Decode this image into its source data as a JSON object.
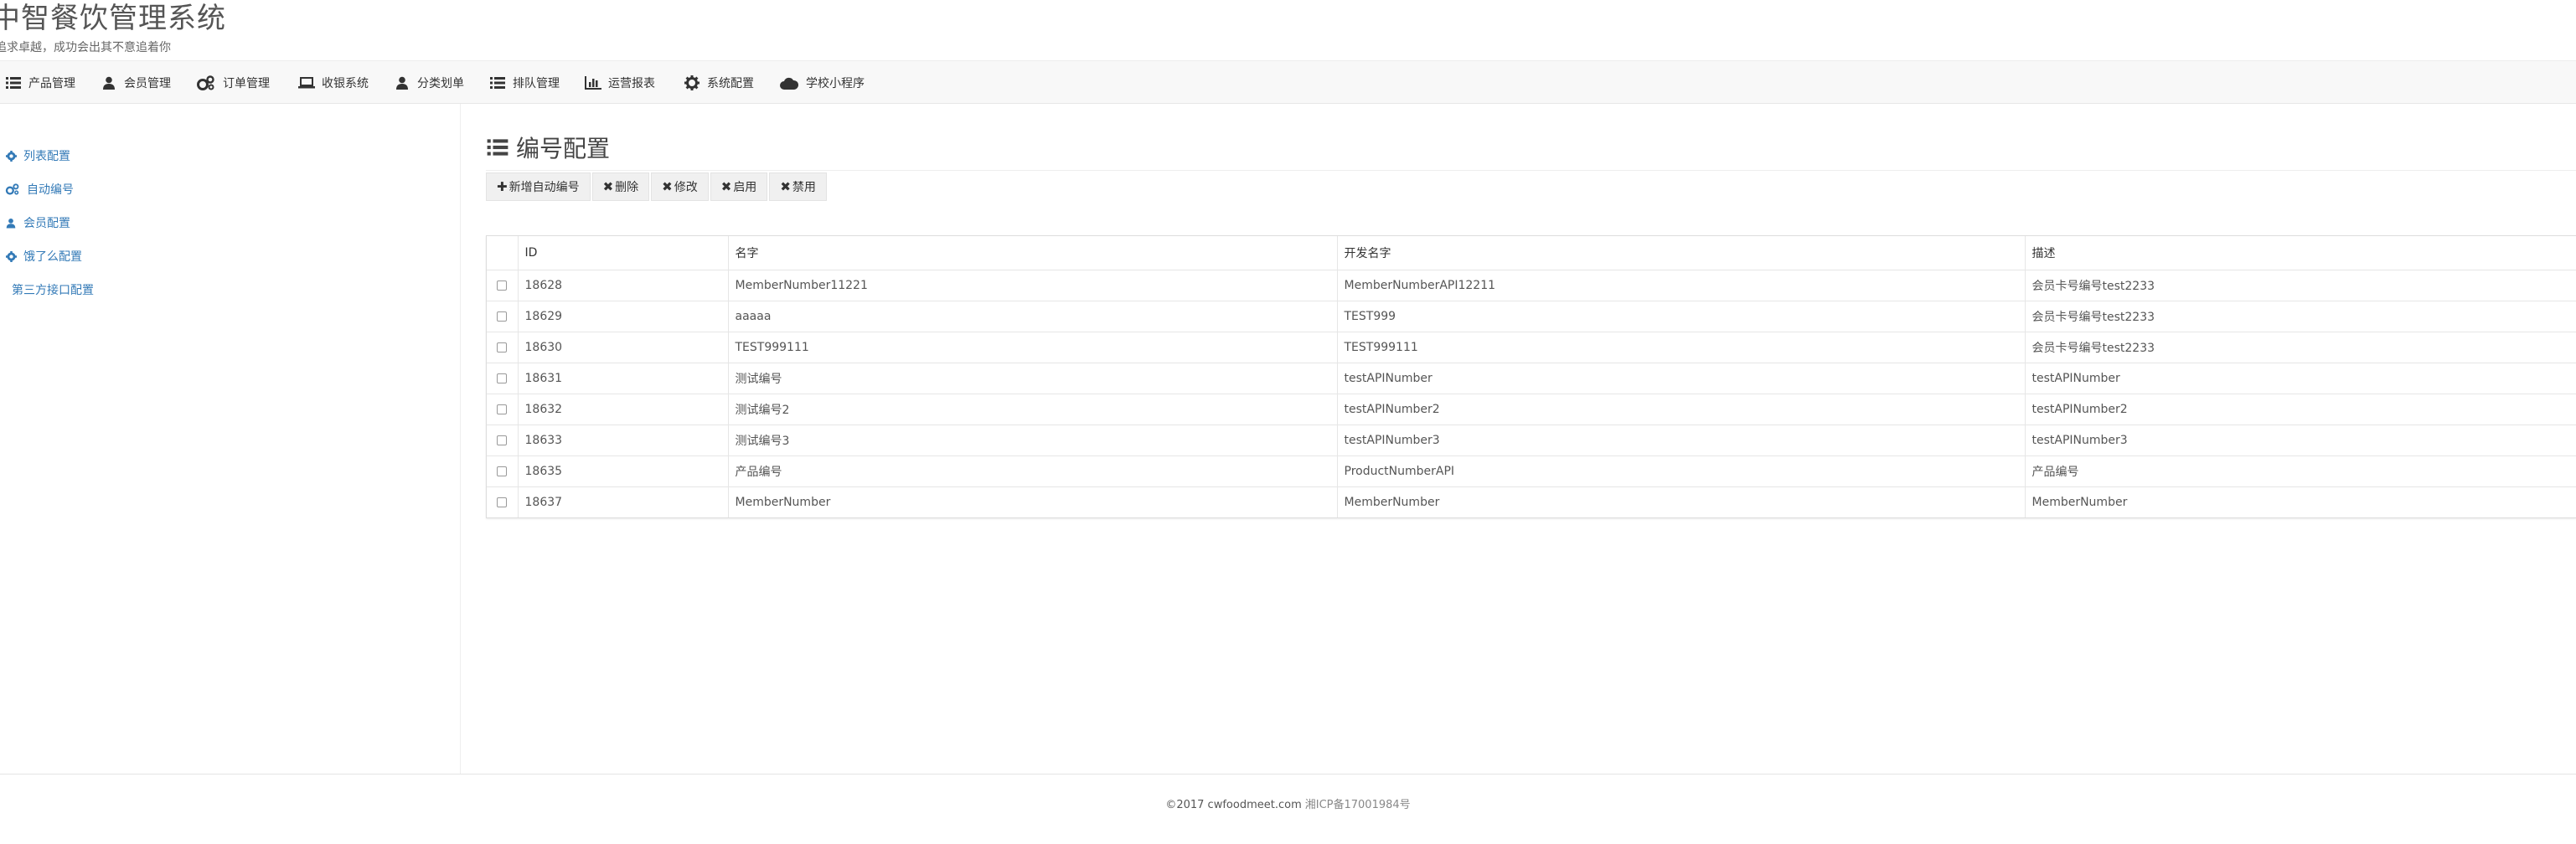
{
  "app": {
    "title": "中智餐饮管理系统",
    "slogan": "追求卓越，成功会出其不意追着你"
  },
  "nav": {
    "items": [
      {
        "label": "产品管理",
        "icon": "list-icon"
      },
      {
        "label": "会员管理",
        "icon": "user-icon"
      },
      {
        "label": "订单管理",
        "icon": "cogs-icon"
      },
      {
        "label": "收银系统",
        "icon": "laptop-icon"
      },
      {
        "label": "分类划单",
        "icon": "user-icon"
      },
      {
        "label": "排队管理",
        "icon": "list-icon"
      },
      {
        "label": "运营报表",
        "icon": "bar-chart-icon"
      },
      {
        "label": "系统配置",
        "icon": "gear-icon"
      },
      {
        "label": "学校小程序",
        "icon": "cloud-icon"
      }
    ]
  },
  "sidebar": {
    "items": [
      {
        "label": "列表配置",
        "icon": "gear-icon"
      },
      {
        "label": "自动编号",
        "icon": "cogs-icon"
      },
      {
        "label": "会员配置",
        "icon": "user-icon"
      },
      {
        "label": "饿了么配置",
        "icon": "gear-icon"
      },
      {
        "label": "第三方接口配置",
        "icon": ""
      }
    ]
  },
  "page": {
    "title": "编号配置",
    "title_icon": "list-icon"
  },
  "toolbar": {
    "add": {
      "label": "新增自动编号",
      "glyph": "✚"
    },
    "delete": {
      "label": "删除",
      "glyph": "✖"
    },
    "edit": {
      "label": "修改",
      "glyph": "✖"
    },
    "enable": {
      "label": "启用",
      "glyph": "✖"
    },
    "disable": {
      "label": "禁用",
      "glyph": "✖"
    }
  },
  "table": {
    "headers": [
      "ID",
      "名字",
      "开发名字",
      "描述"
    ],
    "rows": [
      {
        "id": "18628",
        "name": "MemberNumber11221",
        "dev": "MemberNumberAPI12211",
        "desc": "会员卡号编号test2233"
      },
      {
        "id": "18629",
        "name": "aaaaa",
        "dev": "TEST999",
        "desc": "会员卡号编号test2233"
      },
      {
        "id": "18630",
        "name": "TEST999111",
        "dev": "TEST999111",
        "desc": "会员卡号编号test2233"
      },
      {
        "id": "18631",
        "name": "测试编号",
        "dev": "testAPINumber",
        "desc": "testAPINumber"
      },
      {
        "id": "18632",
        "name": "测试编号2",
        "dev": "testAPINumber2",
        "desc": "testAPINumber2"
      },
      {
        "id": "18633",
        "name": "测试编号3",
        "dev": "testAPINumber3",
        "desc": "testAPINumber3"
      },
      {
        "id": "18635",
        "name": "产品编号",
        "dev": "ProductNumberAPI",
        "desc": "产品编号"
      },
      {
        "id": "18637",
        "name": "MemberNumber",
        "dev": "MemberNumber",
        "desc": "MemberNumber"
      }
    ]
  },
  "footer": {
    "copyright": "©2017 cwfoodmeet.com",
    "icp": "湘ICP备17001984号"
  },
  "colors": {
    "link": "#337ab7",
    "navbar_bg": "#f8f8f8",
    "toolbar_bg": "#f0f0f0"
  }
}
